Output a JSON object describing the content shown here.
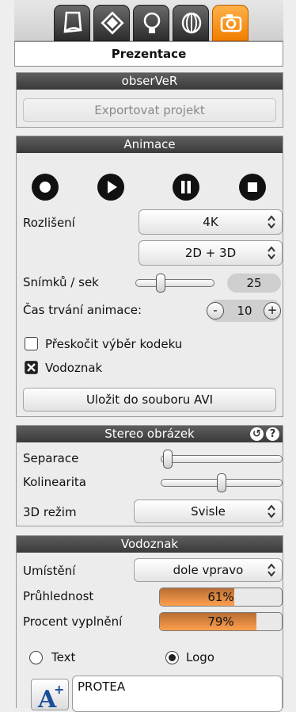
{
  "toolbar": {
    "tabs": [
      {
        "icon": "document-icon"
      },
      {
        "icon": "layers-icon"
      },
      {
        "icon": "lightbulb-icon"
      },
      {
        "icon": "shell-icon"
      },
      {
        "icon": "camera-icon",
        "active": true
      }
    ],
    "subtitle": "Prezentace"
  },
  "observer": {
    "title": "obserVeR",
    "export_label": "Exportovat projekt"
  },
  "animation": {
    "title": "Animace",
    "controls": [
      "record-icon",
      "play-icon",
      "pause-icon",
      "stop-icon"
    ],
    "resolution_label": "Rozlišení",
    "resolution_value": "4K",
    "mode_value": "2D + 3D",
    "fps_label": "Snímků / sek",
    "fps_value": "25",
    "fps_level": 0.3,
    "duration_label": "Čas trvání animace:",
    "duration_minus": "-",
    "duration_value": "10",
    "duration_plus": "+",
    "skip_codec_label": "Přeskočit výběr kodeku",
    "skip_codec_checked": false,
    "watermark_label": "Vodoznak",
    "watermark_checked": true,
    "save_label": "Uložit do souboru AVI"
  },
  "stereo": {
    "title": "Stereo obrázek",
    "separation_label": "Separace",
    "separation_level": 0.02,
    "colinearity_label": "Kolinearita",
    "colinearity_level": 0.5,
    "mode_label": "3D režim",
    "mode_value": "Svisle"
  },
  "watermark": {
    "title": "Vodoznak",
    "placement_label": "Umístění",
    "placement_value": "dole vpravo",
    "opacity_label": "Průhlednost",
    "opacity_value": "61%",
    "opacity_level": 0.61,
    "fill_label": "Procent vyplnění",
    "fill_value": "79%",
    "fill_level": 0.79,
    "text_option": "Text",
    "logo_option": "Logo",
    "selected_option": "Logo",
    "text_value": "PROTEA"
  },
  "colors": {
    "accent": "#f39000",
    "panel_header": "#4a4a4a",
    "bar_fill": "#ffa04d"
  }
}
